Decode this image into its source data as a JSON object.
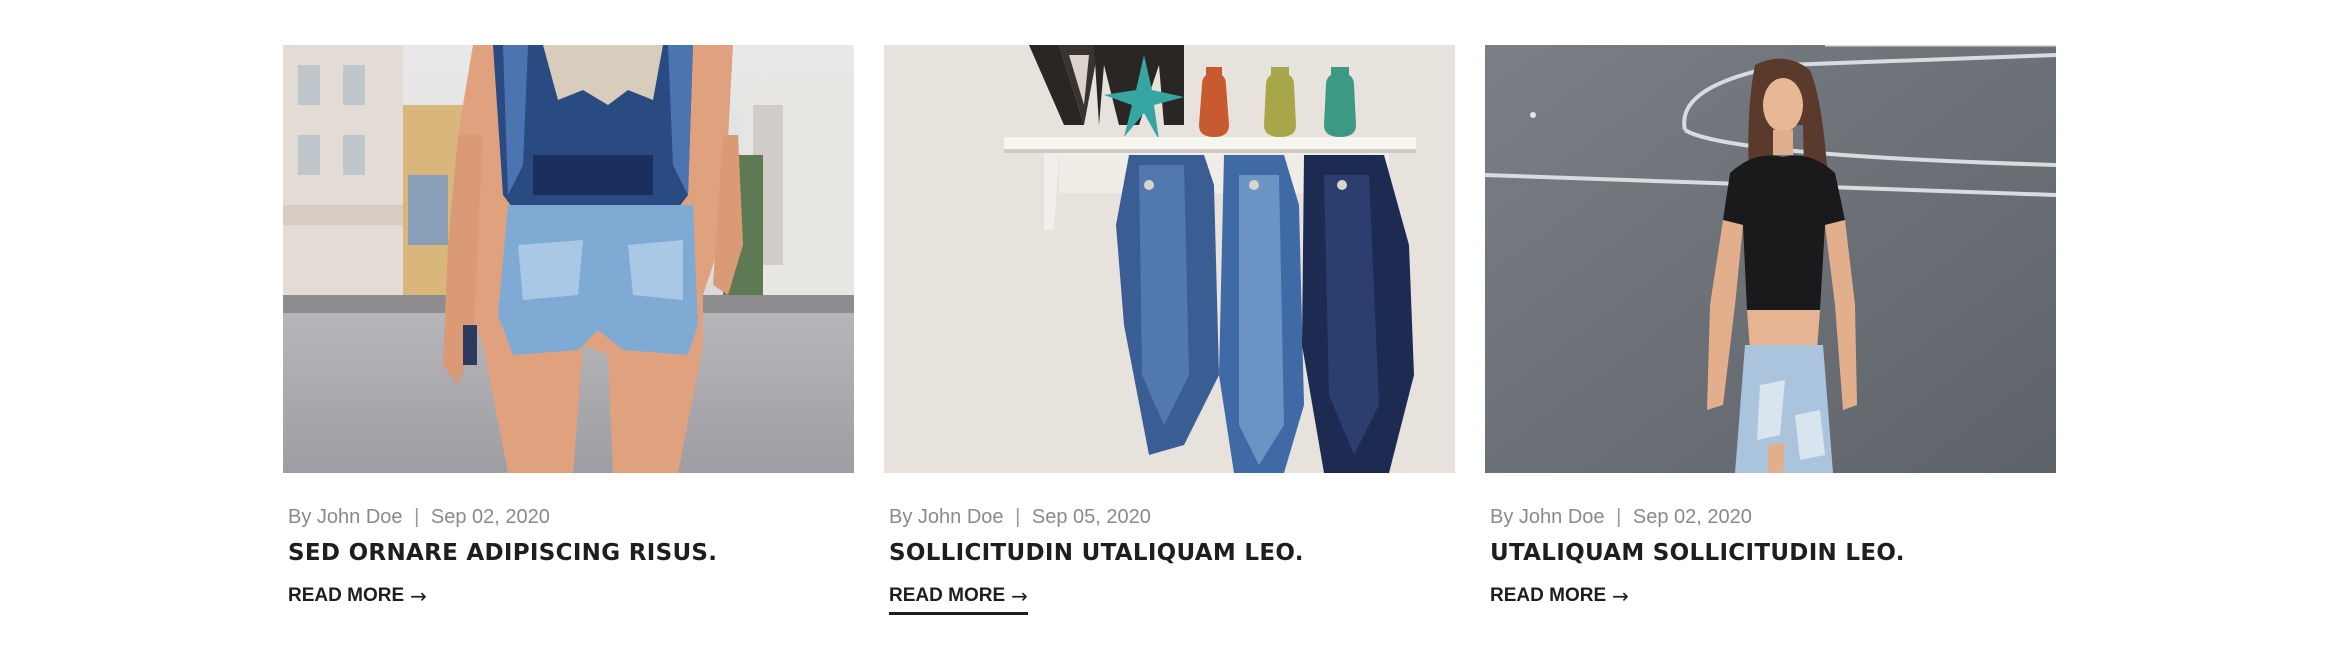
{
  "posts": [
    {
      "image_alt": "Woman in denim shorts walking on street",
      "author_prefix": "By",
      "author": "John Doe",
      "separator": "|",
      "date": "Sep 02, 2020",
      "title": "SED ORNARE ADIPISCING RISUS.",
      "read_more": "READ MORE",
      "arrow": "→"
    },
    {
      "image_alt": "Denim jackets hanging on a wall shelf",
      "author_prefix": "By",
      "author": "John Doe",
      "separator": "|",
      "date": "Sep 05, 2020",
      "title": "SOLLICITUDIN UTALIQUAM LEO.",
      "read_more": "READ MORE",
      "arrow": "→"
    },
    {
      "image_alt": "Woman in black crop top on asphalt court",
      "author_prefix": "By",
      "author": "John Doe",
      "separator": "|",
      "date": "Sep 02, 2020",
      "title": "UTALIQUAM SOLLICITUDIN LEO.",
      "read_more": "READ MORE",
      "arrow": "→"
    }
  ],
  "colors": {
    "title": "#1e1e1e",
    "meta": "#8a8a8a",
    "background": "#ffffff"
  }
}
